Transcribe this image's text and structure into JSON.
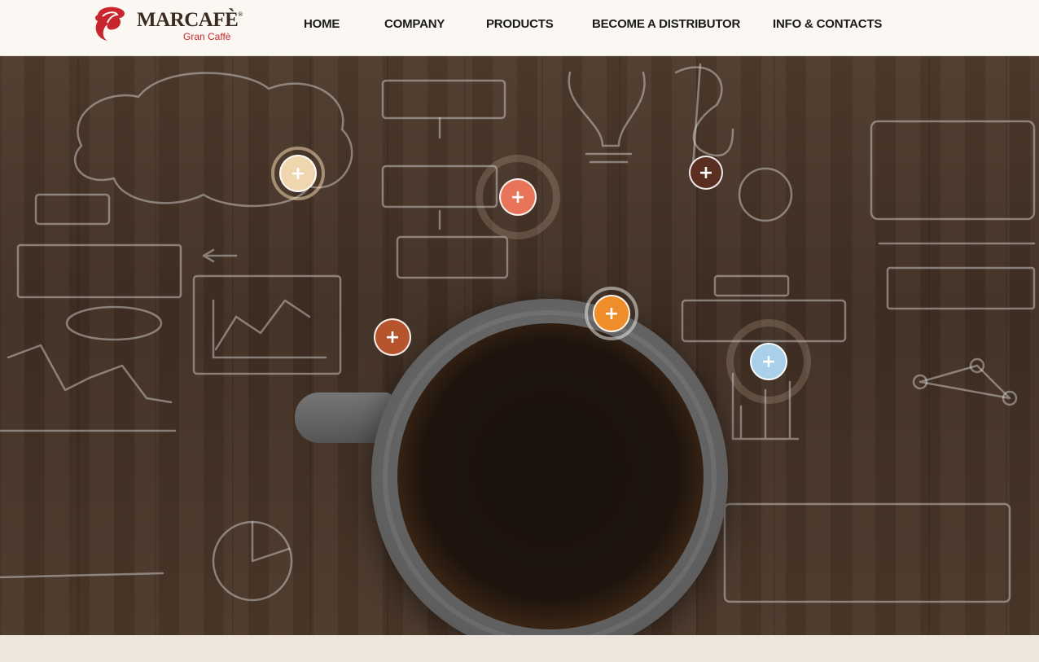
{
  "header": {
    "logo": {
      "brand": "MARCAFÈ",
      "registered": "®",
      "sub": "Gran Caffè"
    },
    "nav": [
      {
        "label": "HOME",
        "id": "home"
      },
      {
        "label": "COMPANY",
        "id": "company"
      },
      {
        "label": "PRODUCTS",
        "id": "products"
      },
      {
        "label": "BECOME A DISTRIBUTOR",
        "id": "become-a-distributor"
      },
      {
        "label": "INFO & CONTACTS",
        "id": "info-contacts"
      }
    ]
  },
  "hero": {
    "hotspots": [
      {
        "id": "cream",
        "symbol": "+",
        "color": "#f0d6ae"
      },
      {
        "id": "coral",
        "symbol": "+",
        "color": "#e8745a"
      },
      {
        "id": "brown",
        "symbol": "+",
        "color": "#5a2e20"
      },
      {
        "id": "orange",
        "symbol": "+",
        "color": "#ee8d2a"
      },
      {
        "id": "rust",
        "symbol": "+",
        "color": "#b6542e"
      },
      {
        "id": "sky",
        "symbol": "+",
        "color": "#a9cfe9"
      }
    ]
  },
  "colors": {
    "brand_red": "#c8262c",
    "header_bg": "#fbf8f3",
    "footer_bg": "#ede6dc",
    "wood": "#46342a"
  }
}
